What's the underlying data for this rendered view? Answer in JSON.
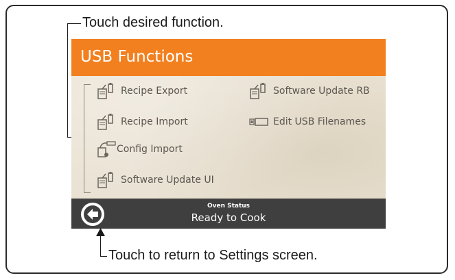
{
  "callouts": {
    "top": "Touch desired function.",
    "bottom": "Touch to return to Settings screen."
  },
  "header": {
    "title": "USB Functions"
  },
  "functions": [
    {
      "label": "Recipe Export",
      "icon": "usb-export-icon"
    },
    {
      "label": "Recipe Import",
      "icon": "usb-import-icon"
    },
    {
      "label": "Config Import",
      "icon": "usb-config-icon"
    },
    {
      "label": "Software Update UI",
      "icon": "usb-update-icon"
    },
    {
      "label": "Software Update RB",
      "icon": "usb-update-icon"
    },
    {
      "label": "Edit USB Filenames",
      "icon": "usb-drive-icon"
    }
  ],
  "status": {
    "label": "Oven Status",
    "text": "Ready to Cook"
  },
  "colors": {
    "header": "#f2801f",
    "status_bar": "#3f3f3f",
    "background": "#e9e1d2",
    "item_text": "#5b5650"
  }
}
